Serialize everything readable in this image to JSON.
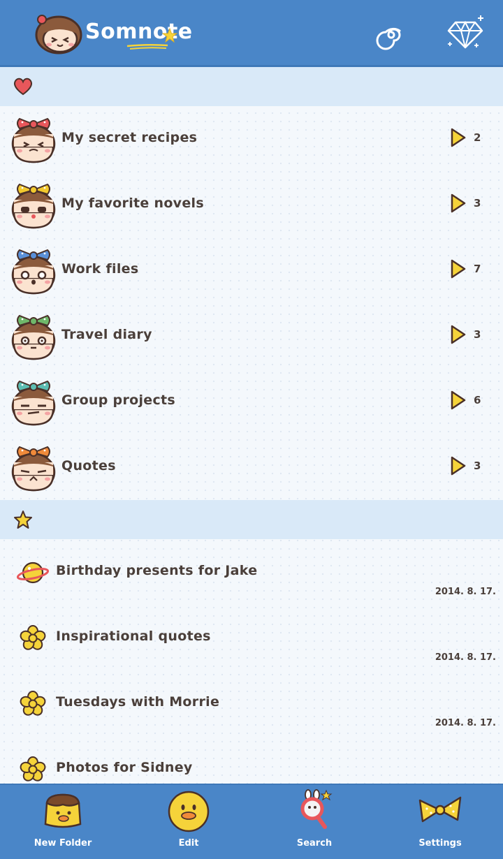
{
  "app": {
    "title": "Somnote"
  },
  "sections": {
    "favorites_icon": "heart-icon",
    "starred_icon": "star-icon"
  },
  "folders": [
    {
      "name": "My secret recipes",
      "count": "2",
      "bow_color": "#e8575b"
    },
    {
      "name": "My favorite novels",
      "count": "3",
      "bow_color": "#f2c92e"
    },
    {
      "name": "Work files",
      "count": "7",
      "bow_color": "#5a90d8"
    },
    {
      "name": "Travel diary",
      "count": "3",
      "bow_color": "#6fb86a"
    },
    {
      "name": "Group projects",
      "count": "6",
      "bow_color": "#5cbdb2"
    },
    {
      "name": "Quotes",
      "count": "3",
      "bow_color": "#f08a3a"
    }
  ],
  "notes": [
    {
      "title": "Birthday presents for Jake",
      "date": "2014. 8. 17.",
      "icon": "planet-icon"
    },
    {
      "title": "Inspirational quotes",
      "date": "2014. 8. 17.",
      "icon": "flower-icon"
    },
    {
      "title": "Tuesdays with Morrie",
      "date": "2014. 8. 17.",
      "icon": "flower-icon"
    },
    {
      "title": "Photos for Sidney",
      "date": "",
      "icon": "flower-icon"
    }
  ],
  "tabbar": {
    "new_folder": "New Folder",
    "edit": "Edit",
    "search": "Search",
    "settings": "Settings"
  },
  "colors": {
    "header": "#4a86c8",
    "section_bg": "#d9e9f8",
    "arrow": "#f5d33a",
    "text": "#4a3f3a"
  }
}
